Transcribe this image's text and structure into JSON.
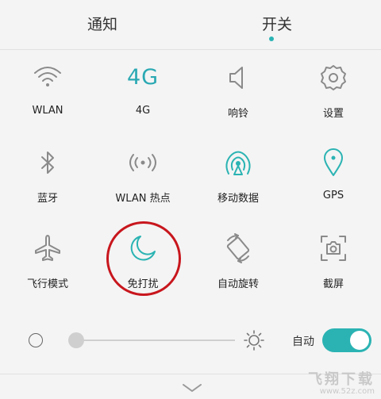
{
  "tabs": {
    "notify": "通知",
    "switch": "开关"
  },
  "tiles": [
    {
      "label": "WLAN",
      "icon": "wifi-icon"
    },
    {
      "label": "4G",
      "icon": "4g-icon",
      "icon_text": "4G"
    },
    {
      "label": "响铃",
      "icon": "speaker-icon"
    },
    {
      "label": "设置",
      "icon": "gear-icon"
    },
    {
      "label": "蓝牙",
      "icon": "bluetooth-icon"
    },
    {
      "label": "WLAN 热点",
      "icon": "hotspot-icon"
    },
    {
      "label": "移动数据",
      "icon": "mobile-data-icon"
    },
    {
      "label": "GPS",
      "icon": "location-pin-icon"
    },
    {
      "label": "飞行模式",
      "icon": "airplane-icon"
    },
    {
      "label": "免打扰",
      "icon": "moon-icon"
    },
    {
      "label": "自动旋转",
      "icon": "rotate-icon"
    },
    {
      "label": "截屏",
      "icon": "camera-icon"
    }
  ],
  "brightness": {
    "level": 0.0,
    "auto_label": "自动",
    "auto_enabled": true
  },
  "watermark": {
    "main": "飞翔下载",
    "sub": "www.52z.com"
  },
  "colors": {
    "accent": "#2bb3b3",
    "icon_gray": "#8a8a8a",
    "highlight_circle": "#c8161d"
  }
}
